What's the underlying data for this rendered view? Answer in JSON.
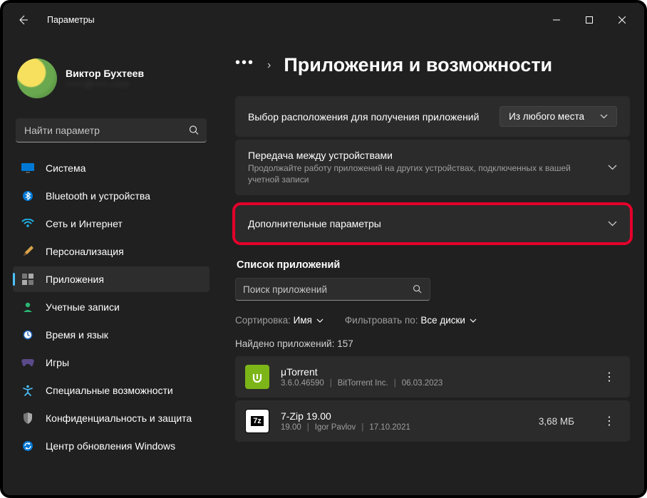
{
  "window": {
    "title": "Параметры"
  },
  "user": {
    "name": "Виктор Бухтеев",
    "email": "•••••@••••.com"
  },
  "search": {
    "placeholder": "Найти параметр"
  },
  "nav": [
    {
      "label": "Система"
    },
    {
      "label": "Bluetooth и устройства"
    },
    {
      "label": "Сеть и Интернет"
    },
    {
      "label": "Персонализация"
    },
    {
      "label": "Приложения"
    },
    {
      "label": "Учетные записи"
    },
    {
      "label": "Время и язык"
    },
    {
      "label": "Игры"
    },
    {
      "label": "Специальные возможности"
    },
    {
      "label": "Конфиденциальность и защита"
    },
    {
      "label": "Центр обновления Windows"
    }
  ],
  "page": {
    "title": "Приложения и возможности"
  },
  "location": {
    "title": "Выбор расположения для получения приложений",
    "value": "Из любого места"
  },
  "sharing": {
    "title": "Передача между устройствами",
    "subtitle": "Продолжайте работу приложений на других устройствах, подключенных к вашей учетной записи"
  },
  "more": {
    "title": "Дополнительные параметры"
  },
  "appList": {
    "header": "Список приложений",
    "searchPlaceholder": "Поиск приложений",
    "sortLabel": "Сортировка:",
    "sortValue": "Имя",
    "filterLabel": "Фильтровать по:",
    "filterValue": "Все диски",
    "foundPrefix": "Найдено приложений:",
    "foundCount": "157",
    "apps": [
      {
        "name": "μTorrent",
        "version": "3.6.0.46590",
        "publisher": "BitTorrent Inc.",
        "date": "06.03.2023",
        "size": ""
      },
      {
        "name": "7-Zip 19.00",
        "version": "19.00",
        "publisher": "Igor Pavlov",
        "date": "17.10.2021",
        "size": "3,68 МБ"
      }
    ]
  }
}
